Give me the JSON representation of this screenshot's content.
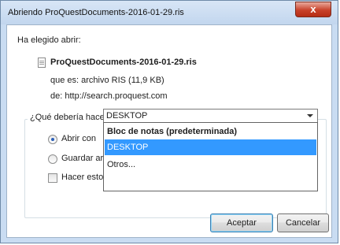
{
  "window": {
    "title": "Abriendo ProQuestDocuments-2016-01-29.ris",
    "close_glyph": "x"
  },
  "dialog": {
    "intro": "Ha elegido abrir:",
    "file_icon": "document-icon",
    "filename": "ProQuestDocuments-2016-01-29.ris",
    "type_line": "que es: archivo RIS (11,9 KB)",
    "from_line": "de: http://search.proquest.com",
    "question": "¿Qué debería hacer Firefox con este archivo?"
  },
  "options": {
    "open_with_label": "Abrir con",
    "open_with_checked": true,
    "save_label": "Guardar arc",
    "save_checked": false,
    "auto_label": "Hacer esto",
    "auto_checked": false
  },
  "app_select": {
    "value": "DESKTOP",
    "items": [
      {
        "label": "Bloc de notas (predeterminada)",
        "bold": true,
        "selected": false
      },
      {
        "label": "DESKTOP",
        "bold": false,
        "selected": true
      },
      {
        "label": "Otros...",
        "bold": false,
        "selected": false
      }
    ]
  },
  "buttons": {
    "accept": "Aceptar",
    "cancel": "Cancelar"
  },
  "colors": {
    "selection": "#3399ff",
    "close_button": "#c8412a",
    "window_frame": "#c9dcf2"
  }
}
